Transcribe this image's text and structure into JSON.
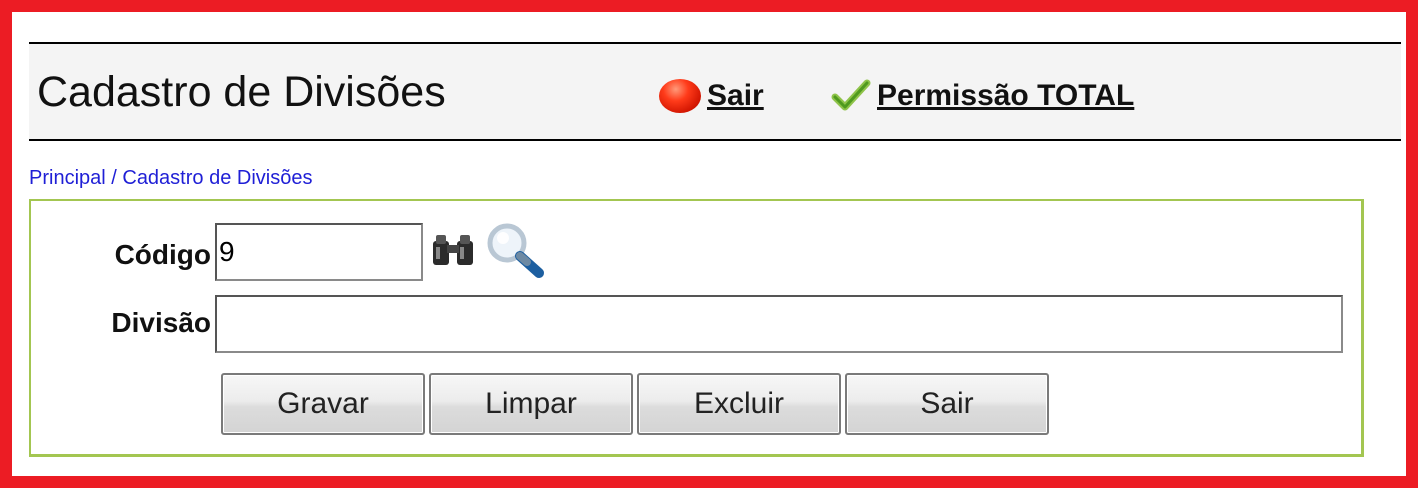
{
  "header": {
    "title": "Cadastro de Divisões",
    "exit_link": "Sair",
    "permission_link": "Permissão TOTAL"
  },
  "breadcrumb": "Principal / Cadastro de Divisões",
  "form": {
    "codigo_label": "Código",
    "codigo_value": "9",
    "divisao_label": "Divisão",
    "divisao_value": ""
  },
  "buttons": {
    "save": "Gravar",
    "clear": "Limpar",
    "delete": "Excluir",
    "exit": "Sair"
  },
  "colors": {
    "frame": "#ec1c24",
    "panel_border": "#a3c651",
    "breadcrumb_link": "#1f1fd6"
  },
  "icons": {
    "exit": "red-circle-icon",
    "permission": "checkmark-icon",
    "search": "binoculars-icon",
    "lookup": "magnifier-icon"
  }
}
